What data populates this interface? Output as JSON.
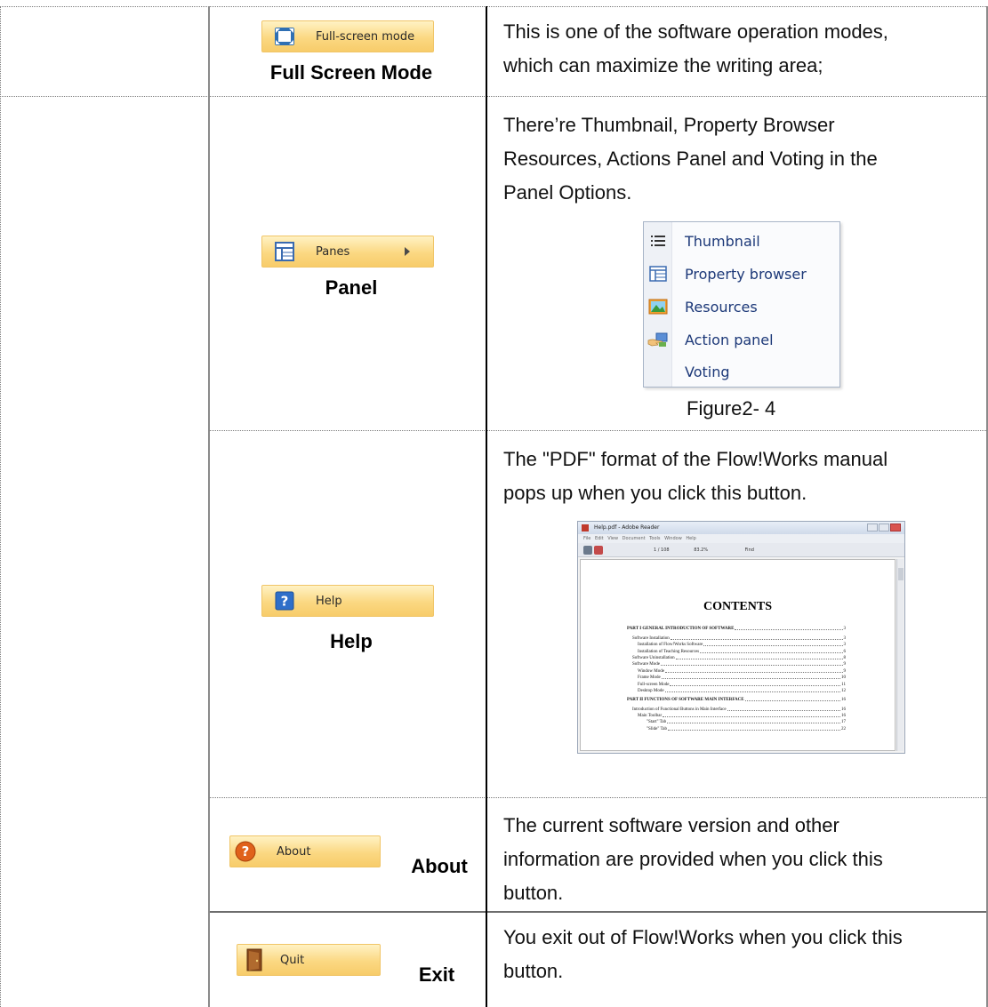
{
  "rows": [
    {
      "button_label": "Full-screen mode",
      "icon": "full-screen-icon",
      "caption": "Full Screen Mode",
      "description": [
        "This is one of the software operation modes,",
        "which can maximize the writing area;"
      ]
    },
    {
      "button_label": "Panes",
      "icon": "panes-icon",
      "caption": "Panel",
      "description": [
        "There’re Thumbnail, Property Browser",
        "Resources, Actions Panel and Voting in the",
        "Panel Options."
      ],
      "menu_items": [
        {
          "label": "Thumbnail",
          "icon": "list-icon"
        },
        {
          "label": "Property browser",
          "icon": "property-grid-icon"
        },
        {
          "label": "Resources",
          "icon": "picture-icon"
        },
        {
          "label": "Action panel",
          "icon": "action-hand-icon"
        },
        {
          "label": "Voting",
          "icon": ""
        }
      ],
      "figure_caption": "Figure2- 4"
    },
    {
      "button_label": "Help",
      "icon": "help-icon",
      "caption": "Help",
      "description": [
        "The \"PDF\" format of the Flow!Works manual",
        "pops up when you click this button."
      ],
      "pdf_window": {
        "title": "Help.pdf - Adobe Reader",
        "menu": "File  Edit  View  Document  Tools  Window  Help",
        "page_indicator": "1   / 108",
        "zoom": "83.2%",
        "find": "Find",
        "heading": "CONTENTS",
        "toc": [
          {
            "text": "PART I GENERAL INTRODUCTION OF SOFTWARE",
            "page": "3",
            "level": 0
          },
          {
            "text": "Software Installation",
            "page": "3",
            "level": 1
          },
          {
            "text": "Installation of Flow!Works Software",
            "page": "3",
            "level": 2
          },
          {
            "text": "Installation of Teaching Resources",
            "page": "6",
            "level": 2
          },
          {
            "text": "Software Uninstallation",
            "page": "8",
            "level": 1
          },
          {
            "text": "Software Mode",
            "page": "9",
            "level": 1
          },
          {
            "text": "Window Mode",
            "page": "9",
            "level": 2
          },
          {
            "text": "Frame Mode",
            "page": "10",
            "level": 2
          },
          {
            "text": "Full-screen Mode",
            "page": "11",
            "level": 2
          },
          {
            "text": "Desktop Mode",
            "page": "12",
            "level": 2
          },
          {
            "text": "PART II FUNCTIONS OF SOFTWARE MAIN INTERFACE",
            "page": "16",
            "level": 0
          },
          {
            "text": "Introduction of Functional Buttons in Main Interface",
            "page": "16",
            "level": 1
          },
          {
            "text": "Main Toolbar",
            "page": "16",
            "level": 2
          },
          {
            "text": "\"Start\" Tab",
            "page": "17",
            "level": 3
          },
          {
            "text": "\"Slide\" Tab",
            "page": "22",
            "level": 3
          }
        ]
      }
    },
    {
      "button_label": "About",
      "icon": "about-icon",
      "caption": "About",
      "description": [
        "The current software version and other",
        "information are provided when you click this",
        "button."
      ]
    },
    {
      "button_label": "Quit",
      "icon": "door-exit-icon",
      "caption": "Exit",
      "description": [
        "You exit out of Flow!Works when you click this",
        "button."
      ]
    }
  ]
}
